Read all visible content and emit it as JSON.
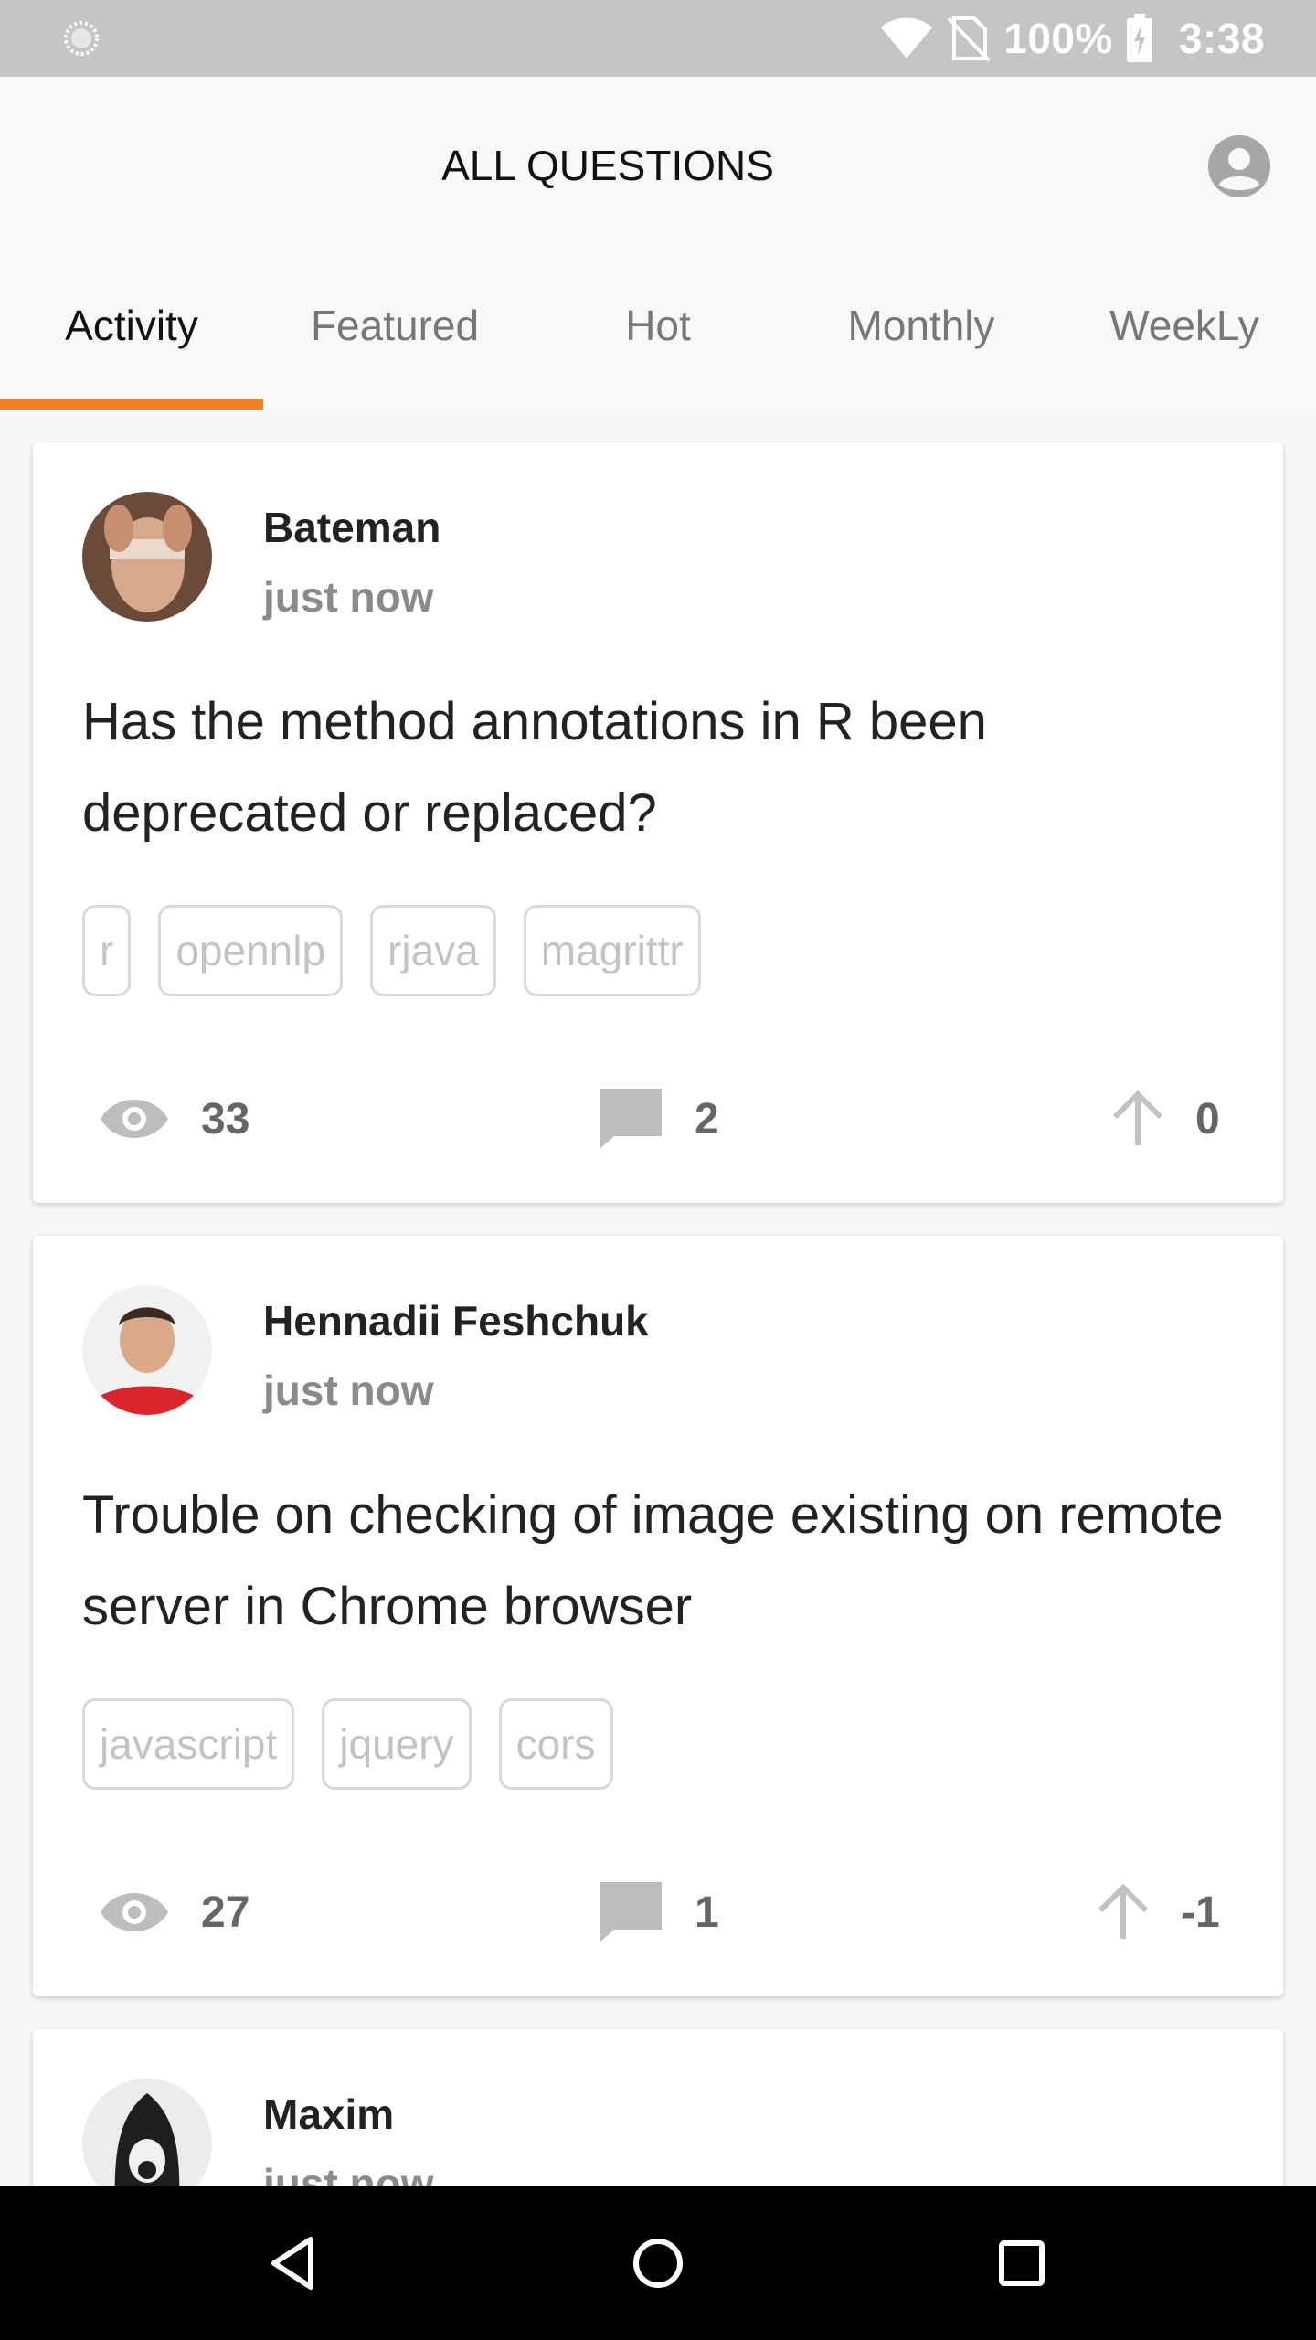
{
  "status_bar": {
    "battery": "100%",
    "time": "3:38"
  },
  "header": {
    "title": "ALL QUESTIONS"
  },
  "tabs": [
    {
      "label": "Activity",
      "active": true
    },
    {
      "label": "Featured",
      "active": false
    },
    {
      "label": "Hot",
      "active": false
    },
    {
      "label": "Monthly",
      "active": false
    },
    {
      "label": "WeekLy",
      "active": false
    }
  ],
  "accent_color": "#f48024",
  "questions": [
    {
      "author": "Bateman",
      "time": "just now",
      "title": "Has the method annotations in R been deprecated or replaced?",
      "tags": [
        "r",
        "opennlp",
        "rjava",
        "magrittr"
      ],
      "views": "33",
      "answers": "2",
      "votes": "0"
    },
    {
      "author": "Hennadii Feshchuk",
      "time": "just now",
      "title": "Trouble on checking of image existing on remote server in Chrome browser",
      "tags": [
        "javascript",
        "jquery",
        "cors"
      ],
      "views": "27",
      "answers": "1",
      "votes": "-1"
    },
    {
      "author": "Maxim",
      "time": "just now"
    }
  ]
}
